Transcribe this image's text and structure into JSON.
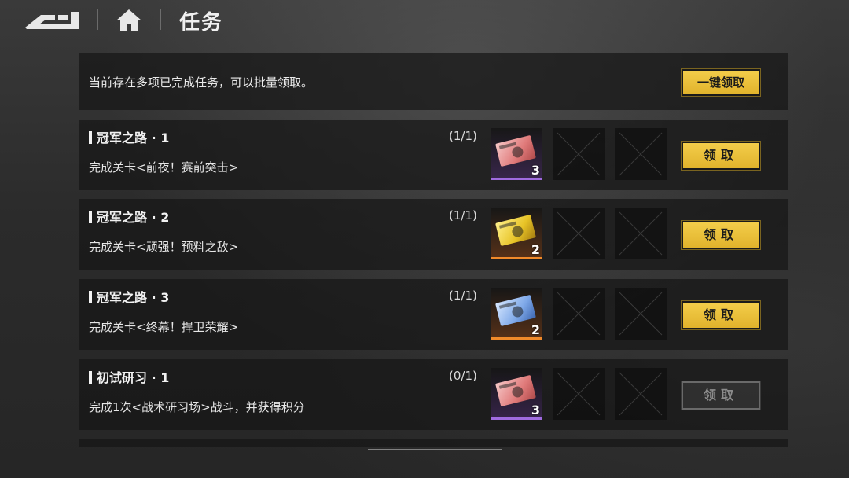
{
  "header": {
    "title": "任务"
  },
  "notice": {
    "text": "当前存在多项已完成任务，可以批量领取。",
    "batch_label": "一键领取"
  },
  "tasks": [
    {
      "title": "冠军之路 · 1",
      "desc": "完成关卡<前夜！赛前突击>",
      "progress": "(1/1)",
      "reward_count": "3",
      "reward_icon": "red-ticket-icon",
      "rarity": "purple",
      "claim_label": "领取",
      "claimable": true
    },
    {
      "title": "冠军之路 · 2",
      "desc": "完成关卡<顽强！预料之敌>",
      "progress": "(1/1)",
      "reward_count": "2",
      "reward_icon": "gold-ticket-icon",
      "rarity": "orange",
      "claim_label": "领取",
      "claimable": true
    },
    {
      "title": "冠军之路 · 3",
      "desc": "完成关卡<终幕！捍卫荣耀>",
      "progress": "(1/1)",
      "reward_count": "2",
      "reward_icon": "blue-ticket-icon",
      "rarity": "orange",
      "claim_label": "领取",
      "claimable": true
    },
    {
      "title": "初试研习 · 1",
      "desc": "完成1次<战术研习场>战斗，并获得积分",
      "progress": "(0/1)",
      "reward_count": "3",
      "reward_icon": "red-ticket-icon",
      "rarity": "purple",
      "claim_label": "领取",
      "claimable": false
    }
  ],
  "colors": {
    "accent_gold": "#f3cd4a",
    "rarity_purple": "#a06be0",
    "rarity_orange": "#f08a2a"
  }
}
